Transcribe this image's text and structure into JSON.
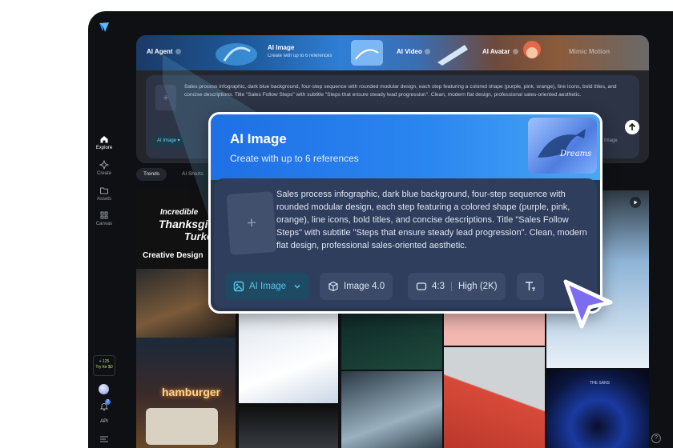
{
  "sidebar": {
    "items": [
      {
        "label": "Explore",
        "icon": "home-icon"
      },
      {
        "label": "Create",
        "icon": "sparkle-icon"
      },
      {
        "label": "Assets",
        "icon": "folder-icon"
      },
      {
        "label": "Canvas",
        "icon": "canvas-icon"
      }
    ],
    "credit": {
      "line1": "+ 125",
      "line2": "Try for $0"
    },
    "notification_count": "2",
    "api_label": "API"
  },
  "banner": {
    "tabs": [
      {
        "label": "AI Agent"
      },
      {
        "label": "AI Image",
        "subtitle": "Create with up to 6 references"
      },
      {
        "label": "AI Video"
      },
      {
        "label": "AI Avatar"
      },
      {
        "label": "Mimic Motion"
      }
    ],
    "prompt": "Sales process infographic, dark blue background, four-step sequence with rounded modular design, each step featuring a colored shape (purple, pink, orange), line icons, bold titles, and concise descriptions. Title \"Sales Follow Steps\" with subtitle \"Steps that ensure steady lead progression\". Clean, modern flat design, professional sales-oriented aesthetic.",
    "mode_chip": "AI Image",
    "right_label": "Image"
  },
  "feed": {
    "tabs": [
      "Trends",
      "AI Shorts"
    ],
    "tiles": [
      {
        "title_line1": "Incredible",
        "title_line2": "Thanksgiving",
        "title_line3": "Turkey",
        "caption": "Creative Design"
      },
      {
        "caption": "hamburger"
      },
      {
        "caption": "THE SANS"
      }
    ]
  },
  "card": {
    "title": "AI Image",
    "subtitle": "Create with up to 6 references",
    "art_text": "Dreams",
    "prompt": "Sales process infographic, dark blue background, four-step sequence with rounded modular design, each step featuring a colored shape (purple, pink, orange), line icons, bold titles, and concise descriptions. Title \"Sales Follow Steps\" with subtitle \"Steps that ensure steady lead progression\". Clean, modern flat design, professional sales-oriented aesthetic.",
    "chips": {
      "mode": "AI Image",
      "model": "Image 4.0",
      "ratio": "4:3",
      "quality": "High (2K)"
    }
  },
  "colors": {
    "accent_blue": "#2a86f0",
    "chip_accent": "#58c6ee",
    "cursor": "#7b6cf2",
    "app_bg": "#0e1013"
  }
}
